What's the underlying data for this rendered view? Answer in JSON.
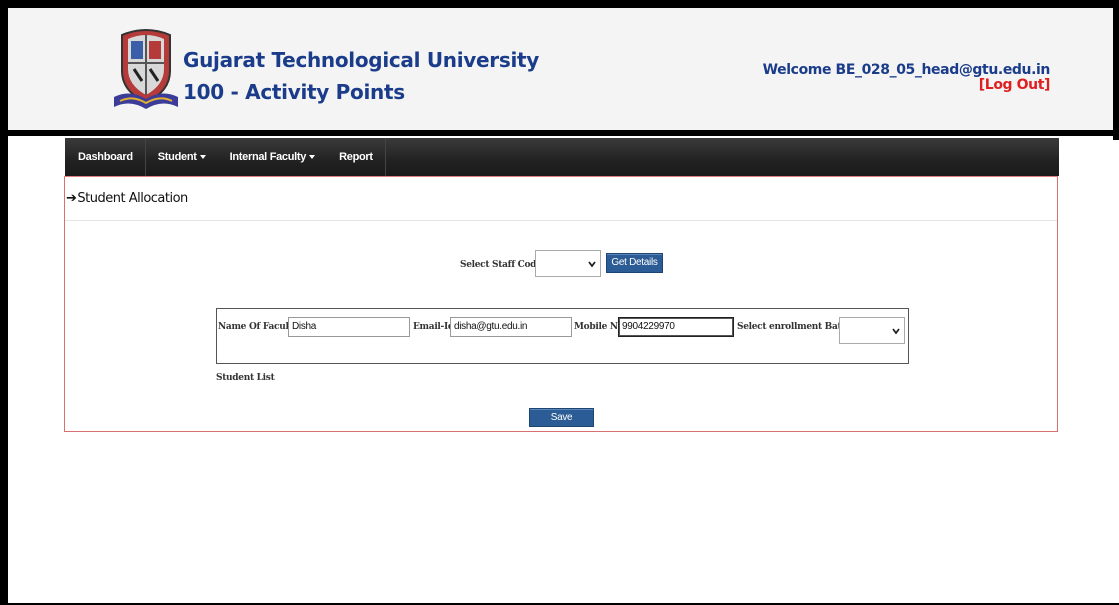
{
  "header": {
    "title": "Gujarat Technological University",
    "subtitle": "100 - Activity Points",
    "welcome": "Welcome BE_028_05_head@gtu.edu.in",
    "logout": "[Log Out]"
  },
  "nav": {
    "items": [
      {
        "label": "Dashboard",
        "dropdown": false
      },
      {
        "label": "Student",
        "dropdown": true
      },
      {
        "label": "Internal Faculty",
        "dropdown": true
      },
      {
        "label": "Report",
        "dropdown": false
      }
    ]
  },
  "page": {
    "section_title": "Student Allocation",
    "arrow": "➔"
  },
  "form": {
    "staff_code_label": "Select Staff Code",
    "staff_code_value": "",
    "get_details_label": "Get Details",
    "faculty_name_label": "Name Of Faculty",
    "faculty_name_value": "Disha",
    "email_label": "Email-Id",
    "email_value": "disha@gtu.edu.in",
    "mobile_label": "Mobile No",
    "mobile_value": "9904229970",
    "batch_label": "Select enrollment Batch",
    "batch_value": "",
    "student_list_label": "Student List",
    "save_label": "Save"
  },
  "colors": {
    "brand": "#1a3c8a",
    "logout": "#e02020",
    "button": "#2c5c95",
    "navbar": "#222222",
    "content_border": "#d97070"
  },
  "icons": {
    "logo": "gtu-crest-logo",
    "caret": "caret-down-icon",
    "select": "chevron-down-icon"
  }
}
